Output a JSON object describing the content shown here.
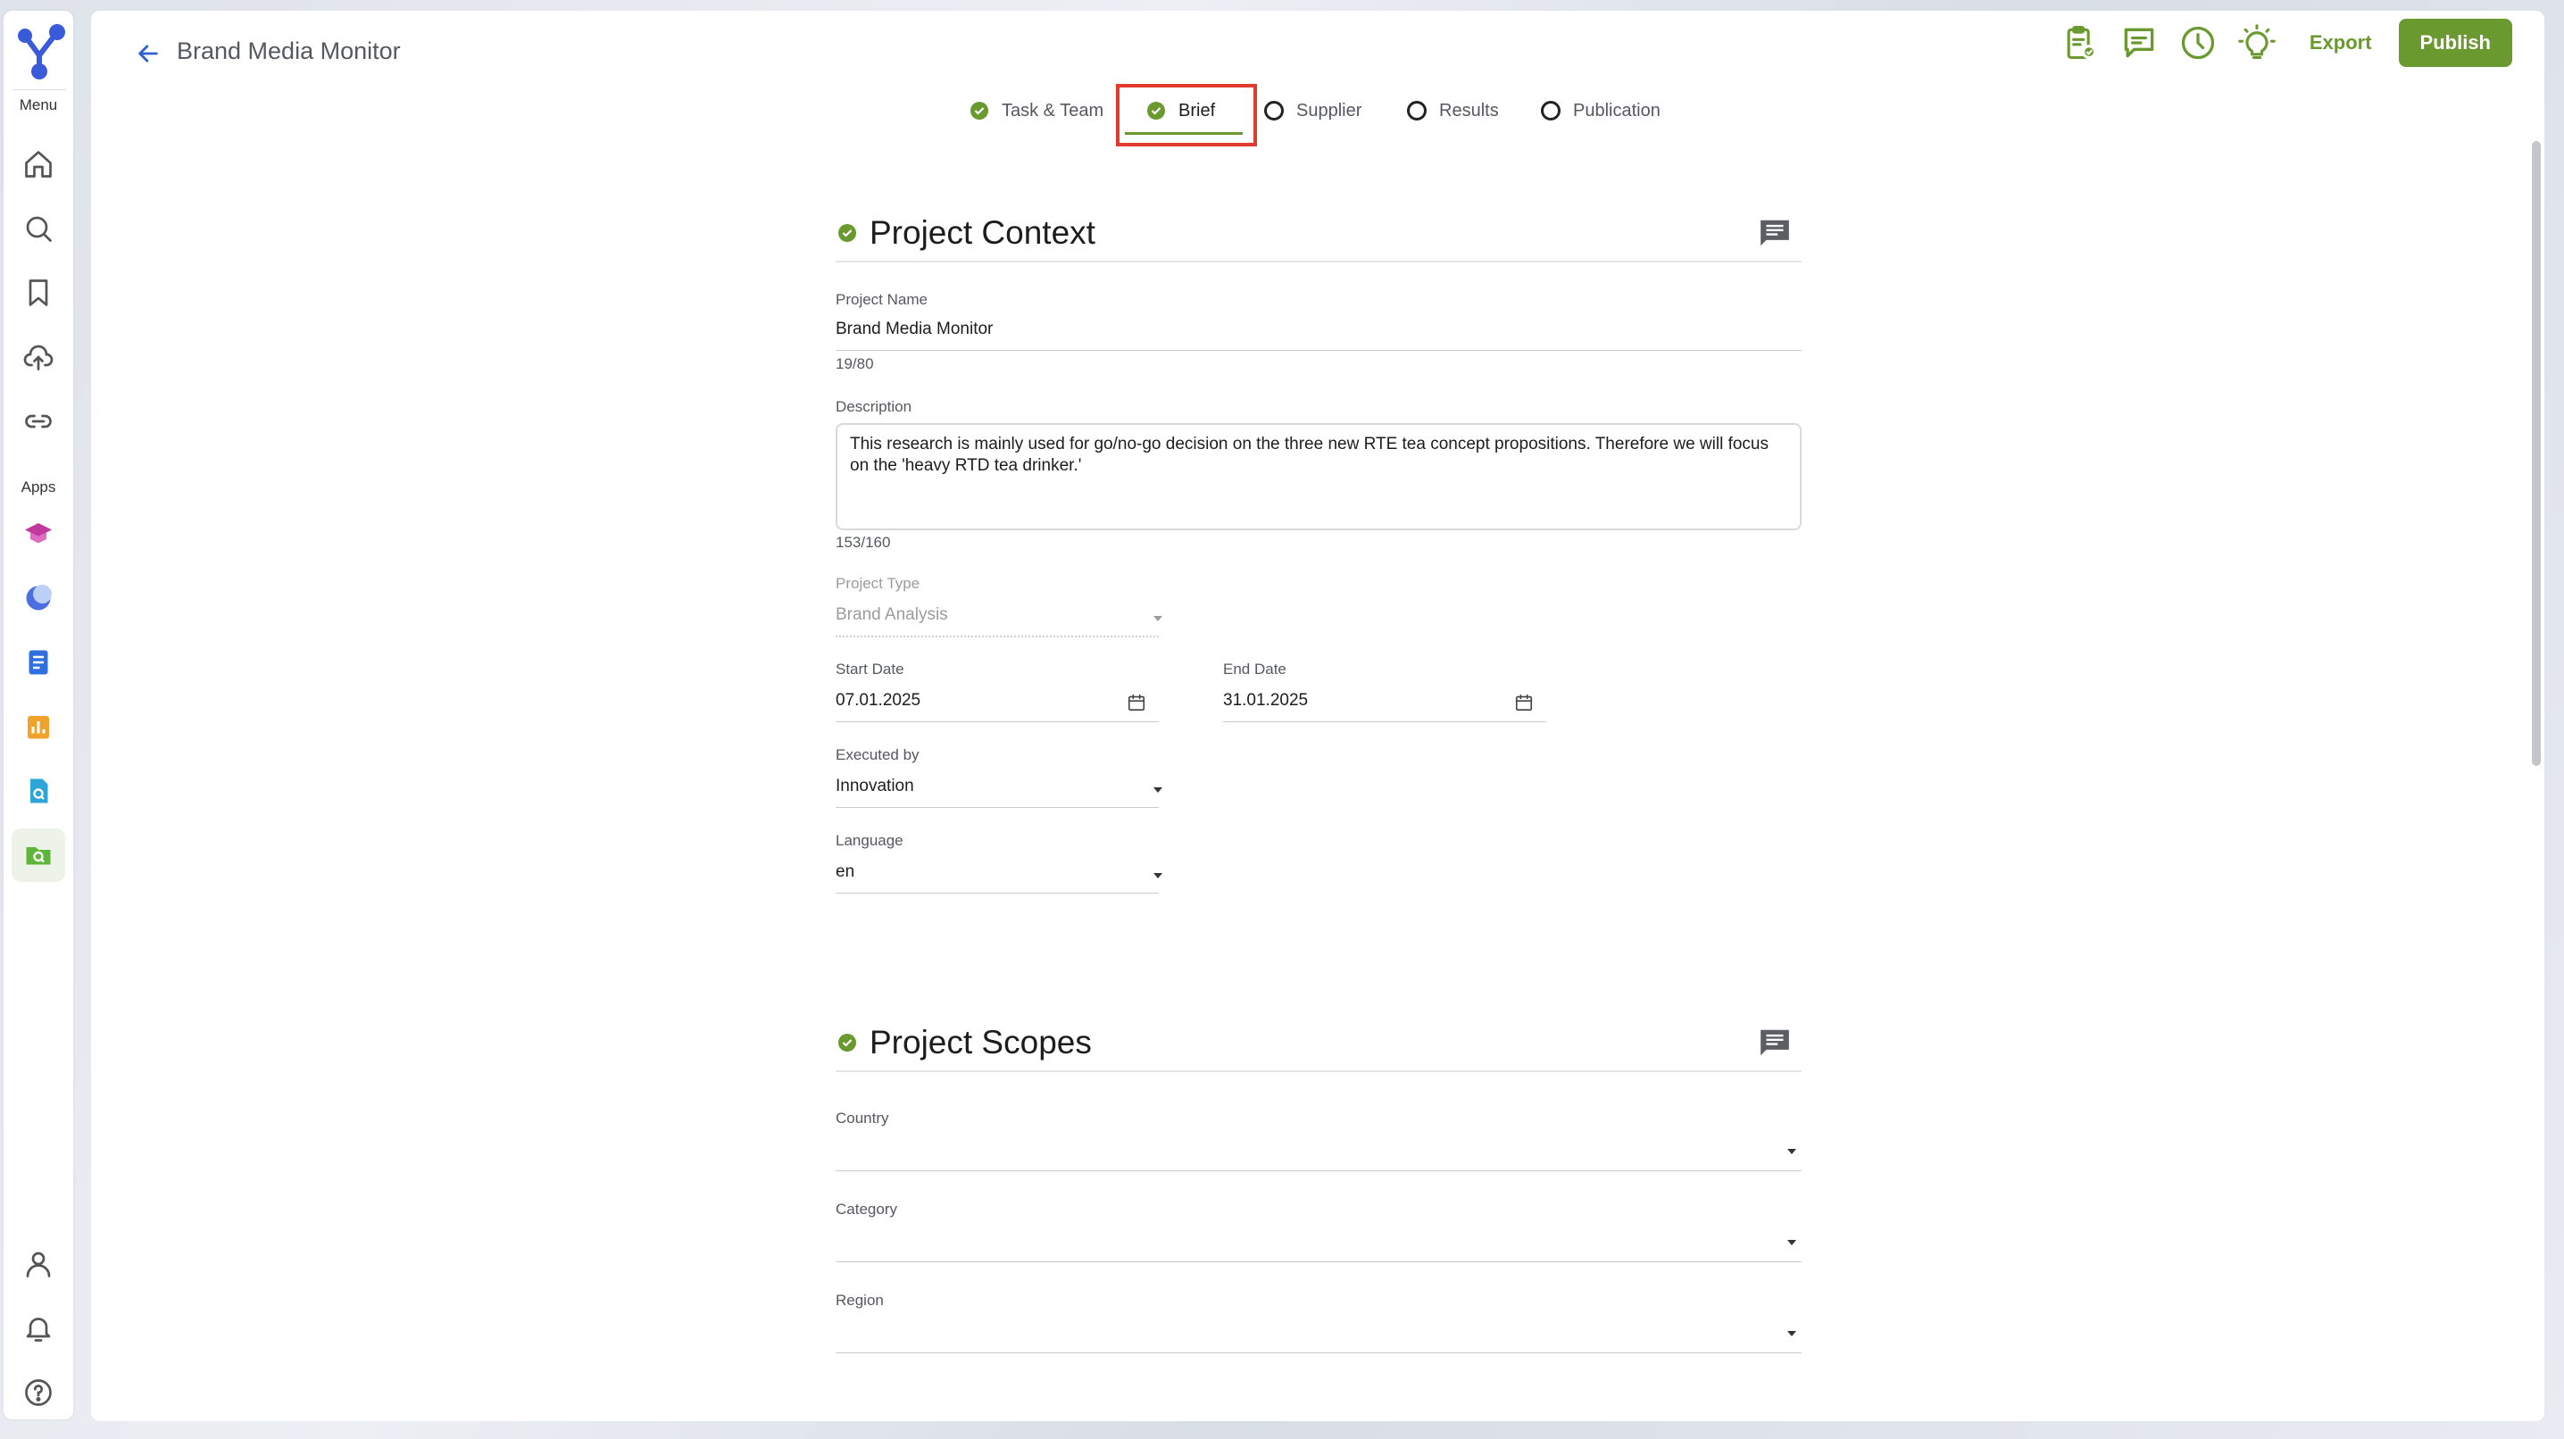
{
  "rail": {
    "menu_label": "Menu",
    "apps_label": "Apps",
    "menu_items": [
      "home-icon",
      "search-icon",
      "bookmark-icon",
      "upload-cloud-icon",
      "link-icon"
    ],
    "app_items": [
      "graduation-cap-app-icon",
      "moon-app-icon",
      "document-app-icon",
      "bar-chart-app-icon",
      "file-search-app-icon",
      "folder-search-app-icon"
    ],
    "bottom_items": [
      "user-icon",
      "bell-icon",
      "help-icon"
    ]
  },
  "header": {
    "title": "Brand Media Monitor",
    "export_label": "Export",
    "publish_label": "Publish",
    "icons": [
      "clipboard-check-icon",
      "chat-icon",
      "clock-icon",
      "lightbulb-icon"
    ]
  },
  "steps": [
    {
      "label": "Task & Team",
      "status": "done"
    },
    {
      "label": "Brief",
      "status": "done",
      "active": true
    },
    {
      "label": "Supplier",
      "status": "todo"
    },
    {
      "label": "Results",
      "status": "todo"
    },
    {
      "label": "Publication",
      "status": "todo"
    }
  ],
  "context": {
    "title": "Project Context",
    "project_name_label": "Project Name",
    "project_name_value": "Brand Media Monitor",
    "project_name_counter": "19/80",
    "description_label": "Description",
    "description_value": "This research is mainly used for go/no-go decision on the three new RTE tea concept propositions. Therefore we will focus on the 'heavy RTD tea drinker.'",
    "description_counter": "153/160",
    "project_type_label": "Project Type",
    "project_type_value": "Brand Analysis",
    "start_date_label": "Start Date",
    "start_date_value": "07.01.2025",
    "end_date_label": "End Date",
    "end_date_value": "31.01.2025",
    "executed_by_label": "Executed by",
    "executed_by_value": "Innovation",
    "language_label": "Language",
    "language_value": "en"
  },
  "scopes": {
    "title": "Project Scopes",
    "country_label": "Country",
    "country_value": "",
    "category_label": "Category",
    "category_value": "",
    "region_label": "Region",
    "region_value": ""
  },
  "colors": {
    "accent": "#6a9a2f",
    "highlight": "#e23b2e",
    "logo": "#3a5bd9"
  }
}
